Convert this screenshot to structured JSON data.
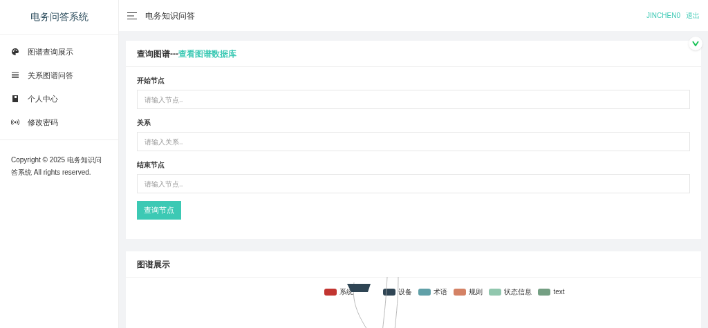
{
  "sidebar": {
    "title": "电务问答系统",
    "items": [
      {
        "label": "图谱查询展示"
      },
      {
        "label": "关系图谱问答"
      },
      {
        "label": "个人中心"
      },
      {
        "label": "修改密码"
      }
    ],
    "footer": "Copyright © 2025 电务知识问答系统 All rights reserved."
  },
  "header": {
    "title": "电务知识问答",
    "user": "JINCHEN0",
    "logout": "退出"
  },
  "query_card": {
    "title": "查询图谱---",
    "link": "查看图谱数据库",
    "fields": [
      {
        "label": "开始节点",
        "placeholder": "请输入节点.."
      },
      {
        "label": "关系",
        "placeholder": "请输入关系.."
      },
      {
        "label": "结束节点",
        "placeholder": "请输入节点.."
      }
    ],
    "button": "查询节点"
  },
  "graph_card": {
    "title": "图谱展示",
    "legend": [
      {
        "label": "系统",
        "color": "#c23531"
      },
      {
        "label": "设备",
        "color": "#2f4554"
      },
      {
        "label": "术语",
        "color": "#61a0a8"
      },
      {
        "label": "规则",
        "color": "#d48265"
      },
      {
        "label": "状态信息",
        "color": "#91c7ae"
      },
      {
        "label": "text",
        "color": "#749f83"
      }
    ]
  }
}
